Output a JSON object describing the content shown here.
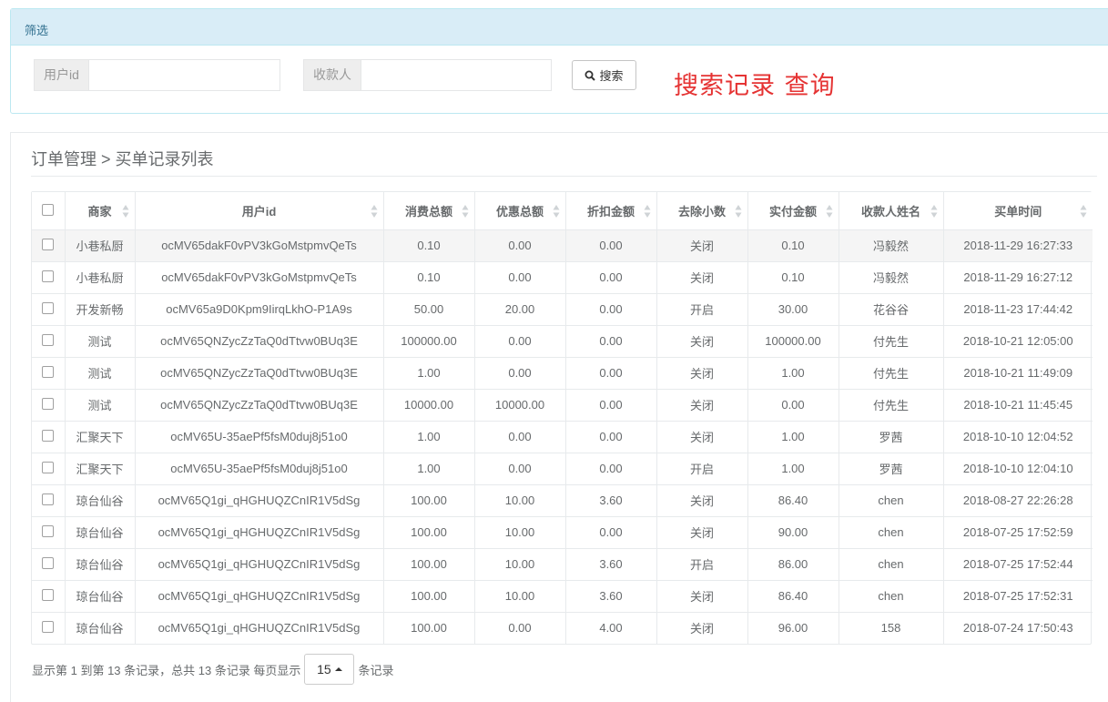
{
  "filter": {
    "heading": "筛选",
    "user_id_label": "用户id",
    "user_id_value": "",
    "payee_label": "收款人",
    "payee_value": "",
    "search_label": "搜索",
    "annotation": "搜索记录  查询"
  },
  "breadcrumb": "订单管理 > 买单记录列表",
  "table": {
    "columns": [
      "商家",
      "用户id",
      "消费总额",
      "优惠总额",
      "折扣金额",
      "去除小数",
      "实付金额",
      "收款人姓名",
      "买单时间"
    ],
    "rows": [
      [
        "小巷私厨",
        "ocMV65dakF0vPV3kGoMstpmvQeTs",
        "0.10",
        "0.00",
        "0.00",
        "关闭",
        "0.10",
        "冯毅然",
        "2018-11-29 16:27:33"
      ],
      [
        "小巷私厨",
        "ocMV65dakF0vPV3kGoMstpmvQeTs",
        "0.10",
        "0.00",
        "0.00",
        "关闭",
        "0.10",
        "冯毅然",
        "2018-11-29 16:27:12"
      ],
      [
        "开发新畅",
        "ocMV65a9D0Kpm9IirqLkhO-P1A9s",
        "50.00",
        "20.00",
        "0.00",
        "开启",
        "30.00",
        "花谷谷",
        "2018-11-23 17:44:42"
      ],
      [
        "测试",
        "ocMV65QNZycZzTaQ0dTtvw0BUq3E",
        "100000.00",
        "0.00",
        "0.00",
        "关闭",
        "100000.00",
        "付先生",
        "2018-10-21 12:05:00"
      ],
      [
        "测试",
        "ocMV65QNZycZzTaQ0dTtvw0BUq3E",
        "1.00",
        "0.00",
        "0.00",
        "关闭",
        "1.00",
        "付先生",
        "2018-10-21 11:49:09"
      ],
      [
        "测试",
        "ocMV65QNZycZzTaQ0dTtvw0BUq3E",
        "10000.00",
        "10000.00",
        "0.00",
        "关闭",
        "0.00",
        "付先生",
        "2018-10-21 11:45:45"
      ],
      [
        "汇聚天下",
        "ocMV65U-35aePf5fsM0duj8j51o0",
        "1.00",
        "0.00",
        "0.00",
        "关闭",
        "1.00",
        "罗茜",
        "2018-10-10 12:04:52"
      ],
      [
        "汇聚天下",
        "ocMV65U-35aePf5fsM0duj8j51o0",
        "1.00",
        "0.00",
        "0.00",
        "开启",
        "1.00",
        "罗茜",
        "2018-10-10 12:04:10"
      ],
      [
        "琼台仙谷",
        "ocMV65Q1gi_qHGHUQZCnIR1V5dSg",
        "100.00",
        "10.00",
        "3.60",
        "关闭",
        "86.40",
        "chen",
        "2018-08-27 22:26:28"
      ],
      [
        "琼台仙谷",
        "ocMV65Q1gi_qHGHUQZCnIR1V5dSg",
        "100.00",
        "10.00",
        "0.00",
        "关闭",
        "90.00",
        "chen",
        "2018-07-25 17:52:59"
      ],
      [
        "琼台仙谷",
        "ocMV65Q1gi_qHGHUQZCnIR1V5dSg",
        "100.00",
        "10.00",
        "3.60",
        "开启",
        "86.00",
        "chen",
        "2018-07-25 17:52:44"
      ],
      [
        "琼台仙谷",
        "ocMV65Q1gi_qHGHUQZCnIR1V5dSg",
        "100.00",
        "10.00",
        "3.60",
        "关闭",
        "86.40",
        "chen",
        "2018-07-25 17:52:31"
      ],
      [
        "琼台仙谷",
        "ocMV65Q1gi_qHGHUQZCnIR1V5dSg",
        "100.00",
        "0.00",
        "4.00",
        "关闭",
        "96.00",
        "158",
        "2018-07-24 17:50:43"
      ]
    ]
  },
  "pager": {
    "summary": "显示第 1 到第 13 条记录，总共 13 条记录 每页显示",
    "page_size": "15",
    "suffix": "条记录"
  }
}
